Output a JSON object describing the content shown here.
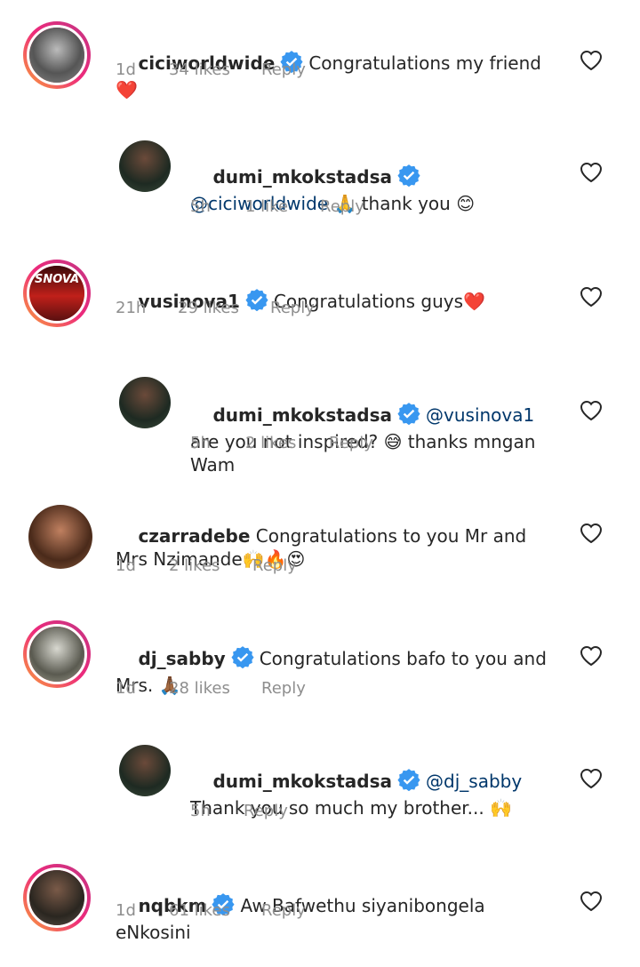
{
  "comments": [
    {
      "username": "ciciworldwide",
      "verified": true,
      "text": "Congratulations my friend ❤️",
      "time": "1d",
      "likes": "34 likes",
      "reply": "Reply"
    },
    {
      "username": "dumi_mkokstadsa",
      "verified": true,
      "mention": "@ciciworldwide",
      "text": " 🙏 thank you 😊",
      "time": "5h",
      "likes": "1 like",
      "reply": "Reply"
    },
    {
      "username": "vusinova1",
      "verified": true,
      "text": "Congratulations guys❤️",
      "time": "21h",
      "likes": "29 likes",
      "reply": "Reply"
    },
    {
      "username": "dumi_mkokstadsa",
      "verified": true,
      "mention": "@vusinova1",
      "text": " are you not inspired? 😅 thanks mngan Wam",
      "time": "5h",
      "likes": "2 likes",
      "reply": "Reply"
    },
    {
      "username": "czarradebe",
      "verified": false,
      "text": "Congratulations to you Mr and Mrs Nzimande🙌🔥😍",
      "time": "1d",
      "likes": "2 likes",
      "reply": "Reply"
    },
    {
      "username": "dj_sabby",
      "verified": true,
      "text": "Congratulations bafo to you and Mrs. 🙏🏾",
      "time": "1d",
      "likes": "28 likes",
      "reply": "Reply"
    },
    {
      "username": "dumi_mkokstadsa",
      "verified": true,
      "mention": "@dj_sabby",
      "text": " Thank you so much my brother... 🙌",
      "time": "5h",
      "likes": "",
      "reply": "Reply"
    },
    {
      "username": "nqbkm",
      "verified": true,
      "text": "Aw Bafwethu siyanibongela eNkosini",
      "time": "1d",
      "likes": "61 likes",
      "reply": "Reply"
    }
  ],
  "avatar_labels": {
    "vusinova1": "SNOVA"
  },
  "colors": {
    "verified": "#3897f0",
    "mention": "#00376b",
    "meta": "#8e8e8e",
    "text": "#262626"
  }
}
